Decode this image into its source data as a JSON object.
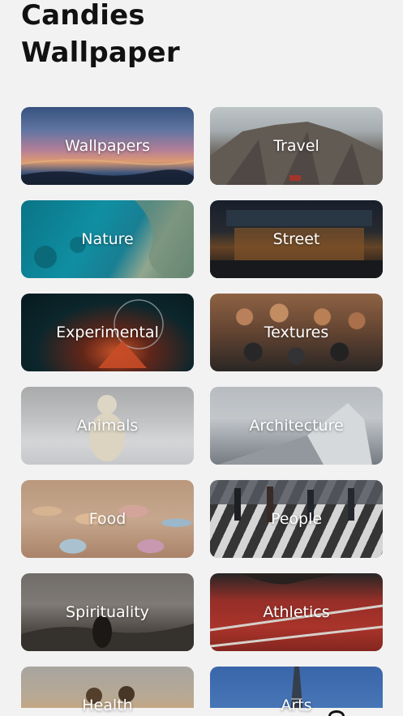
{
  "header": {
    "title": "Candies\nWallpaper"
  },
  "categories": [
    {
      "label": "Wallpapers"
    },
    {
      "label": "Travel"
    },
    {
      "label": "Nature"
    },
    {
      "label": "Street"
    },
    {
      "label": "Experimental"
    },
    {
      "label": "Textures"
    },
    {
      "label": "Animals"
    },
    {
      "label": "Architecture"
    },
    {
      "label": "Food"
    },
    {
      "label": "People"
    },
    {
      "label": "Spirituality"
    },
    {
      "label": "Athletics"
    },
    {
      "label": "Health"
    },
    {
      "label": "Arts"
    }
  ],
  "colors": {
    "background": "#f2f2f2",
    "title": "#111111",
    "tile_text": "#ffffff"
  }
}
